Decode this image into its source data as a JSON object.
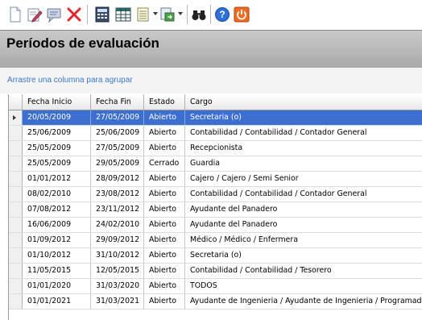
{
  "toolbar": {
    "buttons": [
      {
        "name": "new-document-icon"
      },
      {
        "name": "edit-icon"
      },
      {
        "name": "comment-icon"
      },
      {
        "name": "delete-icon"
      },
      {
        "name": "calculator-icon"
      },
      {
        "name": "grid-layout-icon"
      },
      {
        "name": "columns-icon"
      },
      {
        "name": "export-icon"
      },
      {
        "name": "find-binoculars-icon"
      },
      {
        "name": "help-icon"
      },
      {
        "name": "power-icon"
      }
    ]
  },
  "panel": {
    "title": "Períodos de evaluación",
    "group_hint": "Arrastre una columna para agrupar"
  },
  "grid": {
    "columns": [
      "Fecha Inicio",
      "Fecha Fin",
      "Estado",
      "Cargo"
    ],
    "selected_row": 0,
    "rows": [
      [
        "20/05/2009",
        "27/05/2009",
        "Abierto",
        "Secretaria (o)"
      ],
      [
        "25/06/2009",
        "25/06/2009",
        "Abierto",
        "Contabilidad / Contabilidad / Contador General"
      ],
      [
        "25/05/2009",
        "27/05/2009",
        "Abierto",
        "Recepcionista"
      ],
      [
        "25/05/2009",
        "29/05/2009",
        "Cerrado",
        "Guardia"
      ],
      [
        "01/01/2012",
        "28/09/2012",
        "Abierto",
        "Cajero / Cajero / Semi Senior"
      ],
      [
        "08/02/2010",
        "23/08/2012",
        "Abierto",
        "Contabilidad / Contabilidad / Contador General"
      ],
      [
        "07/08/2012",
        "23/11/2012",
        "Abierto",
        "Ayudante del Panadero"
      ],
      [
        "16/06/2009",
        "24/02/2010",
        "Abierto",
        "Ayudante del Panadero"
      ],
      [
        "01/09/2012",
        "29/09/2012",
        "Abierto",
        "Médico / Médico / Enfermera"
      ],
      [
        "01/10/2012",
        "31/10/2012",
        "Abierto",
        "Secretaria (o)"
      ],
      [
        "11/05/2015",
        "12/05/2015",
        "Abierto",
        "Contabilidad / Contabilidad / Tesorero"
      ],
      [
        "01/01/2020",
        "31/03/2020",
        "Abierto",
        "TODOS"
      ],
      [
        "01/01/2021",
        "31/03/2021",
        "Abierto",
        "Ayudante de Ingenieria / Ayudante de Ingenieria / Programador"
      ]
    ]
  }
}
